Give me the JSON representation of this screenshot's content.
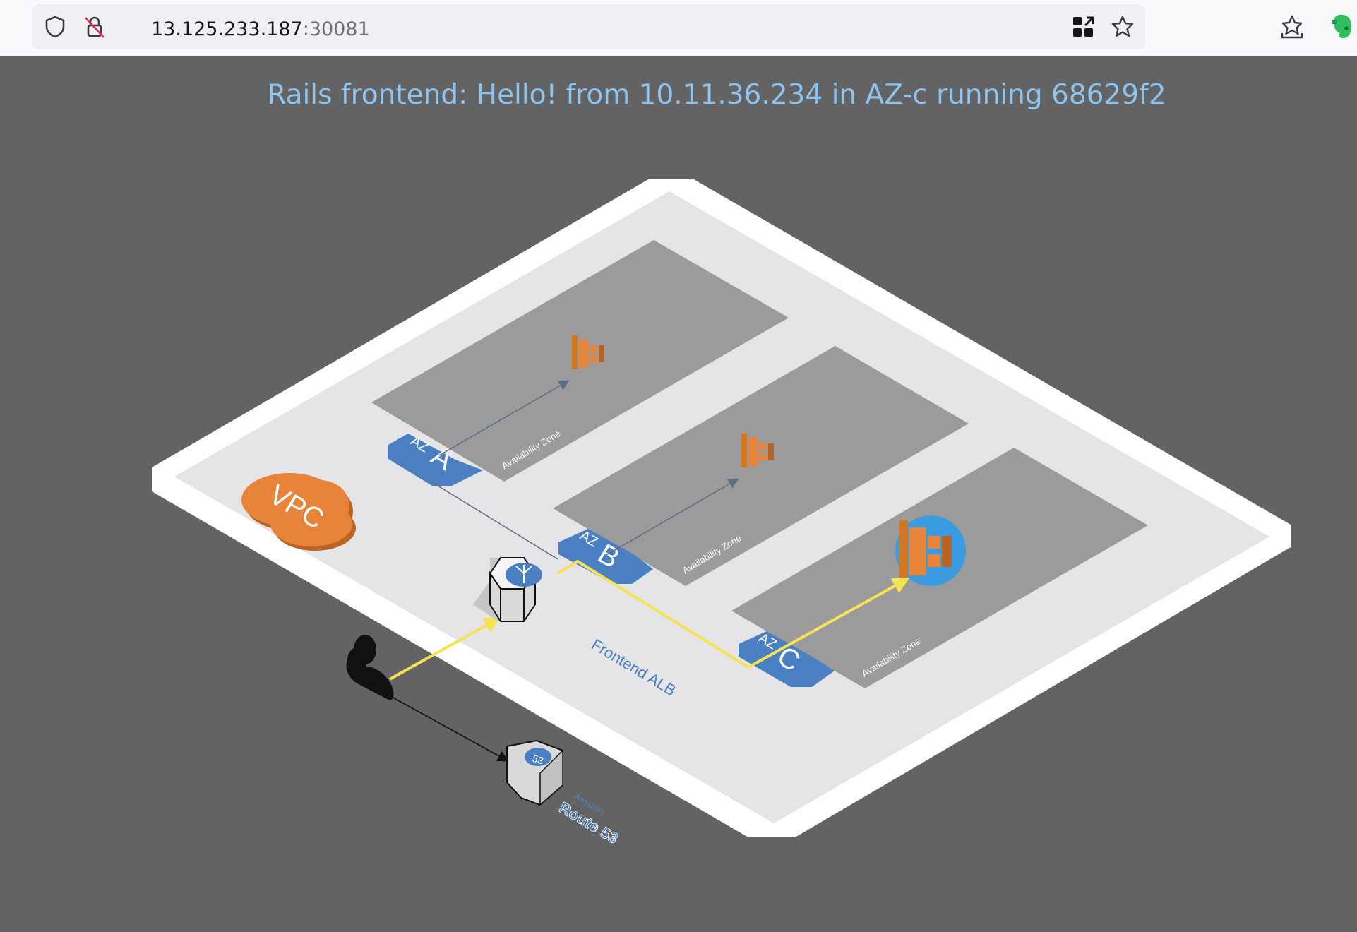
{
  "browser": {
    "url_host": "13.125.233.187",
    "url_port": ":30081",
    "icons": [
      "shield-icon",
      "insecure-lock-icon",
      "qr-code-icon",
      "bookmark-star-icon",
      "save-to-pocket-icon",
      "evernote-extension-icon"
    ]
  },
  "page": {
    "heading": "Rails frontend: Hello! from 10.11.36.234 in AZ-c running 68629f2"
  },
  "diagram": {
    "vpc_label": "VPC",
    "zones": [
      {
        "badge_prefix": "AZ",
        "badge_letter": "A",
        "caption": "Availability Zone",
        "active": false
      },
      {
        "badge_prefix": "AZ",
        "badge_letter": "B",
        "caption": "Availability Zone",
        "active": false
      },
      {
        "badge_prefix": "AZ",
        "badge_letter": "C",
        "caption": "Availability Zone",
        "active": true
      }
    ],
    "alb_label": "Frontend ALB",
    "route53_small": "Amazon",
    "route53_label": "Route 53",
    "route53_badge": "53",
    "colors": {
      "background": "#636363",
      "platform_border": "#ffffff",
      "platform": "#e5e5e7",
      "zone": "#9b9b9b",
      "badge": "#4a7fc1",
      "vpc": "#e8843a",
      "traffic": "#f5e356",
      "heading": "#8ec4f0"
    }
  }
}
